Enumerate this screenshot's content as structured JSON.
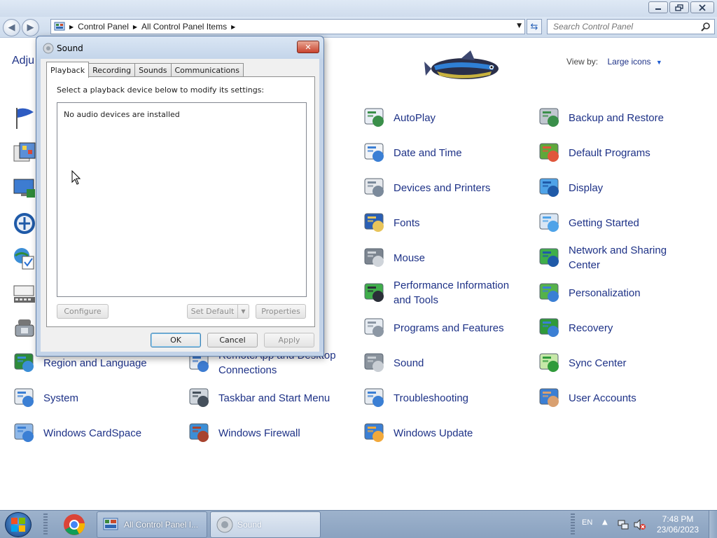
{
  "window": {
    "caption_buttons": [
      "minimize-icon",
      "restore-icon",
      "close-icon"
    ],
    "address": {
      "crumbs": [
        "Control Panel",
        "All Control Panel Items"
      ]
    },
    "search_placeholder": "Search Control Panel",
    "heading": "Adju",
    "view_by_label": "View by:",
    "view_by_value": "Large icons"
  },
  "items_left_hidden_icons": [
    "flag-icon",
    "monitor-color-icon",
    "remote-monitor-icon",
    "ease-of-access-icon",
    "globe-check-icon",
    "keyboard-icon",
    "phone-modem-icon"
  ],
  "items": [
    {
      "label": "AutoPlay",
      "icon": "autoplay-icon"
    },
    {
      "label": "Backup and Restore",
      "icon": "backup-icon"
    },
    {
      "label": "Date and Time",
      "icon": "clock-calendar-icon"
    },
    {
      "label": "Default Programs",
      "icon": "default-programs-icon"
    },
    {
      "label": "Devices and Printers",
      "icon": "printer-icon"
    },
    {
      "label": "Display",
      "icon": "display-icon"
    },
    {
      "label": "Fonts",
      "icon": "fonts-folder-icon"
    },
    {
      "label": "Getting Started",
      "icon": "getting-started-icon"
    },
    {
      "label": "Mouse",
      "icon": "mouse-icon"
    },
    {
      "label": "Network and Sharing Center",
      "icon": "network-icon"
    },
    {
      "label": "Performance Information and Tools",
      "icon": "performance-icon"
    },
    {
      "label": "Personalization",
      "icon": "personalization-icon"
    },
    {
      "label": "Programs and Features",
      "icon": "programs-icon"
    },
    {
      "label": "Recovery",
      "icon": "recovery-icon"
    },
    {
      "label": "Region and Language",
      "icon": "region-globe-icon"
    },
    {
      "label": "RemoteApp and Desktop Connections",
      "icon": "remoteapp-icon"
    },
    {
      "label": "Sound",
      "icon": "speaker-icon"
    },
    {
      "label": "Sync Center",
      "icon": "sync-icon"
    },
    {
      "label": "System",
      "icon": "system-icon"
    },
    {
      "label": "Taskbar and Start Menu",
      "icon": "taskbar-icon"
    },
    {
      "label": "Troubleshooting",
      "icon": "troubleshooting-icon"
    },
    {
      "label": "User Accounts",
      "icon": "user-accounts-icon"
    },
    {
      "label": "Windows CardSpace",
      "icon": "cardspace-icon"
    },
    {
      "label": "Windows Firewall",
      "icon": "firewall-icon"
    },
    {
      "label": "Windows Update",
      "icon": "windows-update-icon"
    }
  ],
  "dialog": {
    "title": "Sound",
    "tabs": [
      "Playback",
      "Recording",
      "Sounds",
      "Communications"
    ],
    "active_tab": "Playback",
    "instruction": "Select a playback device below to modify its settings:",
    "empty_message": "No audio devices are installed",
    "configure": "Configure",
    "set_default": "Set Default",
    "properties": "Properties",
    "ok": "OK",
    "cancel": "Cancel",
    "apply": "Apply"
  },
  "taskbar": {
    "buttons": [
      "All Control Panel I...",
      "Sound"
    ],
    "language": "EN",
    "time": "7:48 PM",
    "date": "23/06/2023"
  }
}
